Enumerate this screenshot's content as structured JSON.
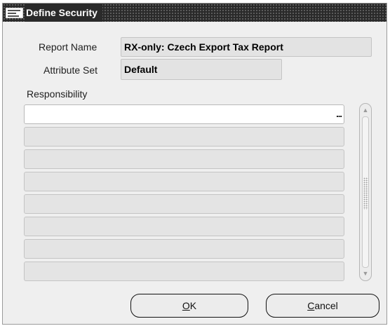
{
  "window": {
    "title": "Define Security",
    "icon": "oracle-app-icon"
  },
  "form": {
    "report_name_label": "Report Name",
    "report_name_value": "RX-only: Czech Export Tax Report",
    "attribute_set_label": "Attribute Set",
    "attribute_set_value": "Default"
  },
  "responsibility": {
    "header": "Responsibility",
    "lov_button": "...",
    "rows": [
      "",
      "",
      "",
      "",
      "",
      "",
      "",
      ""
    ]
  },
  "buttons": {
    "ok_mnemonic": "O",
    "ok_rest": "K",
    "cancel_mnemonic": "C",
    "cancel_rest": "ancel"
  },
  "colors": {
    "titlebar": "#2a2a2a",
    "window_bg": "#efefef",
    "field_bg": "#e3e3e3",
    "active_row_bg": "#ffffff"
  }
}
